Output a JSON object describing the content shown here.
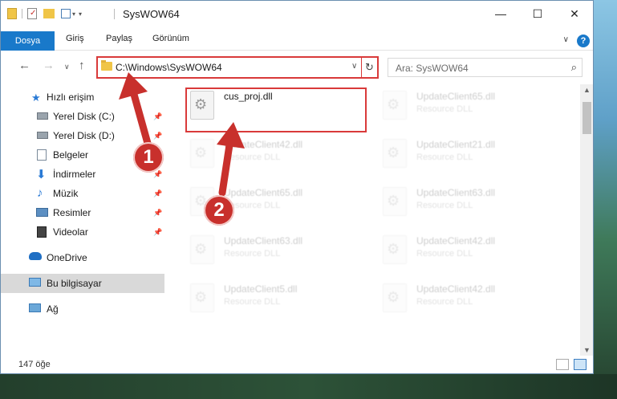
{
  "window": {
    "title": "SysWOW64",
    "minimize": "—",
    "maximize": "☐",
    "close": "✕"
  },
  "ribbon": {
    "file_tab": "Dosya",
    "tabs": [
      "Giriş",
      "Paylaş",
      "Görünüm"
    ],
    "help": "?"
  },
  "address_bar": {
    "path": "C:\\Windows\\SysWOW64",
    "refresh_icon": "↻",
    "dropdown_icon": "∨"
  },
  "search": {
    "placeholder": "Ara: SysWOW64"
  },
  "sidebar": {
    "items": [
      {
        "label": "Hızlı erişim",
        "icon": "star-icon"
      },
      {
        "label": "Yerel Disk (C:)",
        "icon": "drive-icon",
        "pinned": true
      },
      {
        "label": "Yerel Disk (D:)",
        "icon": "drive-icon",
        "pinned": true
      },
      {
        "label": "Belgeler",
        "icon": "documents-icon",
        "pinned": true
      },
      {
        "label": "İndirmeler",
        "icon": "download-icon",
        "pinned": true
      },
      {
        "label": "Müzik",
        "icon": "music-icon",
        "pinned": true
      },
      {
        "label": "Resimler",
        "icon": "pictures-icon",
        "pinned": true
      },
      {
        "label": "Videolar",
        "icon": "videos-icon",
        "pinned": true
      },
      {
        "label": "OneDrive",
        "icon": "cloud-icon"
      },
      {
        "label": "Bu bilgisayar",
        "icon": "computer-icon",
        "selected": true
      },
      {
        "label": "Ağ",
        "icon": "network-icon"
      }
    ]
  },
  "files": [
    {
      "name": "cus_proj.dll",
      "type": "",
      "highlighted": true
    },
    {
      "name": "UpdateClient65.dll",
      "type": "Resource DLL"
    },
    {
      "name": "UpdateClient42.dll",
      "type": "Resource DLL"
    },
    {
      "name": "UpdateClient21.dll",
      "type": "Resource DLL"
    },
    {
      "name": "UpdateClient65.dll",
      "type": "Resource DLL"
    },
    {
      "name": "UpdateClient63.dll",
      "type": "Resource DLL"
    },
    {
      "name": "UpdateClient63.dll",
      "type": "Resource DLL"
    },
    {
      "name": "UpdateClient42.dll",
      "type": "Resource DLL"
    },
    {
      "name": "UpdateClient5.dll",
      "type": "Resource DLL"
    },
    {
      "name": "UpdateClient42.dll",
      "type": "Resource DLL"
    }
  ],
  "status": {
    "item_count": "147 öğe"
  },
  "annotations": {
    "step1": "1",
    "step2": "2",
    "color": "#d93a3a"
  }
}
